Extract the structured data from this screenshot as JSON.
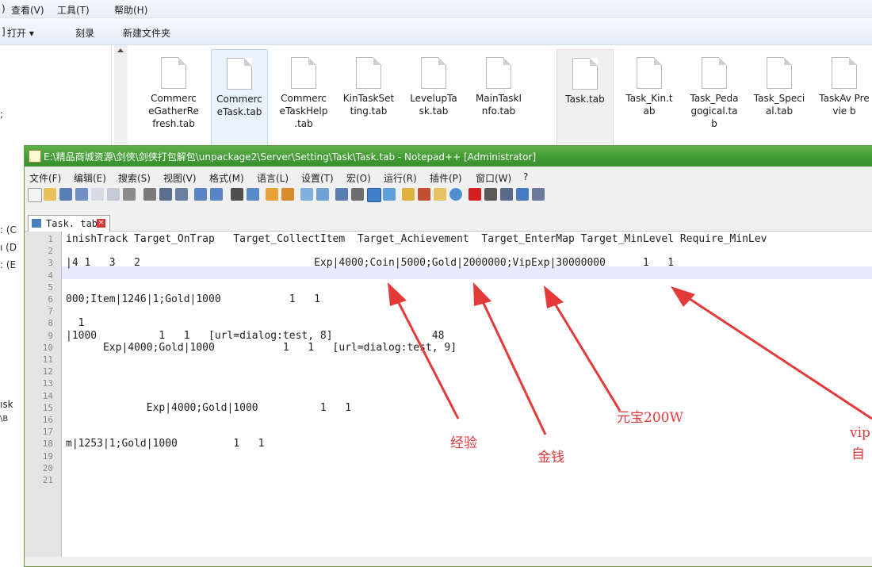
{
  "explorer": {
    "menu": [
      "查看(V)",
      "工具(T)",
      "帮助(H)"
    ],
    "menu_prefix": ")",
    "toolbar": [
      "打开 ▾",
      "刻录",
      "新建文件夹"
    ],
    "toolbar_prefix": "]",
    "left_fragments": [
      ";",
      ": (C",
      "ı (D",
      ": (E",
      "ısk",
      "\\B"
    ],
    "files": [
      {
        "name": "CommerceGatherRefresh.tab",
        "display": "Commerc eGatherRe fresh.tab"
      },
      {
        "name": "CommerceTask.tab",
        "display": "Commerc eTask.tab"
      },
      {
        "name": "CommerceTaskHelp.tab",
        "display": "Commerc eTaskHelp .tab"
      },
      {
        "name": "KinTaskSetting.tab",
        "display": "KinTaskSet ting.tab"
      },
      {
        "name": "LevelupTask.tab",
        "display": "LevelupTa sk.tab"
      },
      {
        "name": "MainTaskInfo.tab",
        "display": "MainTaskI nfo.tab"
      },
      {
        "name": "Task.tab",
        "display": "Task.tab"
      },
      {
        "name": "Task_Kin.tab",
        "display": "Task_Kin.t ab"
      },
      {
        "name": "Task_Pedagogical.tab",
        "display": "Task_Peda gogical.ta b"
      },
      {
        "name": "Task_Special.tab",
        "display": "Task_Speci al.tab"
      },
      {
        "name": "TaskAwardPreview.tab",
        "display": "TaskAv Previe b"
      }
    ]
  },
  "npp": {
    "title": "E:\\精品商城资源\\剑侠\\剑侠打包解包\\unpackage2\\Server\\Setting\\Task\\Task.tab - Notepad++ [Administrator]",
    "menu": [
      "文件(F)",
      "编辑(E)",
      "搜索(S)",
      "视图(V)",
      "格式(M)",
      "语言(L)",
      "设置(T)",
      "宏(O)",
      "运行(R)",
      "插件(P)",
      "窗口(W)",
      "?"
    ],
    "tab_label": "Task. tab",
    "lines": [
      {
        "n": "1",
        "text": "inishTrack Target_OnTrap   Target_CollectItem  Target_Achievement  Target_EnterMap Target_MinLevel Require_MinLev"
      },
      {
        "n": "2",
        "text": ""
      },
      {
        "n": "3",
        "text": "|4 1   3   2                            Exp|4000;Coin|5000;Gold|2000000;VipExp|30000000      1   1"
      },
      {
        "n": "4",
        "text": ""
      },
      {
        "n": "5",
        "text": ""
      },
      {
        "n": "6",
        "text": "000;Item|1246|1;Gold|1000           1   1"
      },
      {
        "n": "7",
        "text": ""
      },
      {
        "n": "8",
        "text": "  1"
      },
      {
        "n": "9",
        "text": "|1000          1   1   [url=dialog:test, 8]                48"
      },
      {
        "n": "10",
        "text": "      Exp|4000;Gold|1000           1   1   [url=dialog:test, 9]"
      },
      {
        "n": "11",
        "text": ""
      },
      {
        "n": "12",
        "text": ""
      },
      {
        "n": "13",
        "text": ""
      },
      {
        "n": "14",
        "text": ""
      },
      {
        "n": "15",
        "text": "             Exp|4000;Gold|1000          1   1"
      },
      {
        "n": "16",
        "text": ""
      },
      {
        "n": "17",
        "text": ""
      },
      {
        "n": "18",
        "text": "m|1253|1;Gold|1000         1   1"
      },
      {
        "n": "19",
        "text": ""
      },
      {
        "n": "20",
        "text": ""
      },
      {
        "n": "21",
        "text": ""
      }
    ]
  },
  "annotations": {
    "exp": "经验",
    "coin": "金钱",
    "gold": "元宝200W",
    "vip_1": "vip",
    "vip_2": "自"
  },
  "colors": {
    "annotation": "#e43a3a",
    "titlebar": "#4ea63e",
    "current_line": "#e8e8ff"
  }
}
